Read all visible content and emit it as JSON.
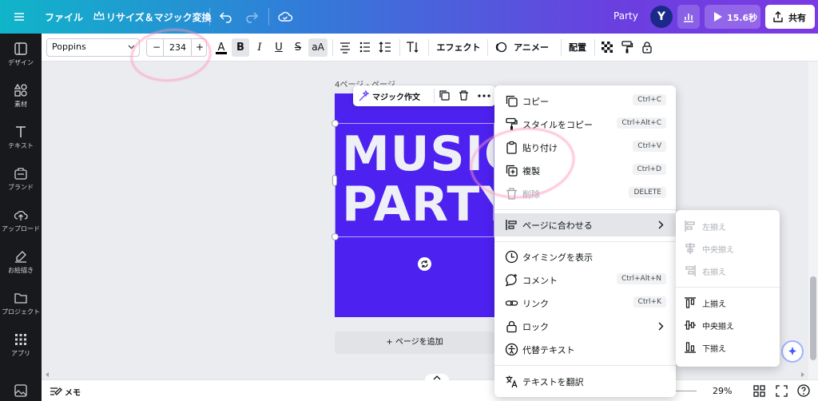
{
  "topbar": {
    "file_menu": "ファイル",
    "resize_label": "リサイズ＆マジック変換",
    "doc_title": "Party",
    "avatar_initial": "Y",
    "present_label": "15.6秒",
    "share_label": "共有"
  },
  "sidebar": {
    "items": [
      {
        "label": "デザイン",
        "icon": "layout-icon"
      },
      {
        "label": "素材",
        "icon": "elements-icon"
      },
      {
        "label": "テキスト",
        "icon": "text-icon"
      },
      {
        "label": "ブランド",
        "icon": "brand-icon"
      },
      {
        "label": "アップロード",
        "icon": "upload-icon"
      },
      {
        "label": "お絵描き",
        "icon": "draw-icon"
      },
      {
        "label": "プロジェクト",
        "icon": "folder-icon"
      },
      {
        "label": "アプリ",
        "icon": "apps-icon"
      }
    ]
  },
  "toolbar": {
    "font_name": "Poppins",
    "font_size": "234",
    "minus": "−",
    "plus": "+",
    "color_glyph": "A",
    "bold": "B",
    "italic": "I",
    "underline": "U",
    "strike": "S",
    "case": "aA",
    "effects_label": "エフェクト",
    "animate_label": "アニメート",
    "position_label": "配置"
  },
  "canvas": {
    "page_header": "4ページ - ページ",
    "design_text_line1": "MUSIC",
    "design_text_line2": "PARTY",
    "page_color": "#4d21f0",
    "magic_write_label": "マジック作文",
    "add_page_label": "+ ページを追加"
  },
  "context_menu": {
    "items": [
      {
        "label": "コピー",
        "shortcut": "Ctrl+C",
        "icon": "copy-icon",
        "disabled": false
      },
      {
        "label": "スタイルをコピー",
        "shortcut": "Ctrl+Alt+C",
        "icon": "paint-roller-icon",
        "disabled": false
      },
      {
        "label": "貼り付け",
        "shortcut": "Ctrl+V",
        "icon": "clipboard-icon",
        "disabled": false
      },
      {
        "label": "複製",
        "shortcut": "Ctrl+D",
        "icon": "duplicate-icon",
        "disabled": false
      },
      {
        "label": "削除",
        "shortcut": "DELETE",
        "icon": "trash-icon",
        "disabled": true
      },
      {
        "label": "ページに合わせる",
        "shortcut": "",
        "icon": "align-page-icon",
        "disabled": false,
        "submenu": true
      },
      {
        "label": "タイミングを表示",
        "shortcut": "",
        "icon": "clock-icon",
        "disabled": false
      },
      {
        "label": "コメント",
        "shortcut": "Ctrl+Alt+N",
        "icon": "comment-icon",
        "disabled": false
      },
      {
        "label": "リンク",
        "shortcut": "Ctrl+K",
        "icon": "link-icon",
        "disabled": false
      },
      {
        "label": "ロック",
        "shortcut": "",
        "icon": "lock-icon",
        "disabled": false,
        "submenu": true
      },
      {
        "label": "代替テキスト",
        "shortcut": "",
        "icon": "accessibility-icon",
        "disabled": false
      },
      {
        "label": "テキストを翻訳",
        "shortcut": "",
        "icon": "translate-icon",
        "disabled": false
      }
    ]
  },
  "submenu": {
    "items": [
      {
        "label": "左揃え",
        "disabled": true,
        "icon": "align-left-icon"
      },
      {
        "label": "中央揃え",
        "disabled": true,
        "icon": "align-center-icon"
      },
      {
        "label": "右揃え",
        "disabled": true,
        "icon": "align-right-icon"
      },
      {
        "label": "上揃え",
        "disabled": false,
        "icon": "align-top-icon"
      },
      {
        "label": "中央揃え",
        "disabled": false,
        "icon": "align-middle-icon"
      },
      {
        "label": "下揃え",
        "disabled": false,
        "icon": "align-bottom-icon"
      }
    ]
  },
  "bottombar": {
    "notes_label": "メモ",
    "zoom": "29%"
  }
}
